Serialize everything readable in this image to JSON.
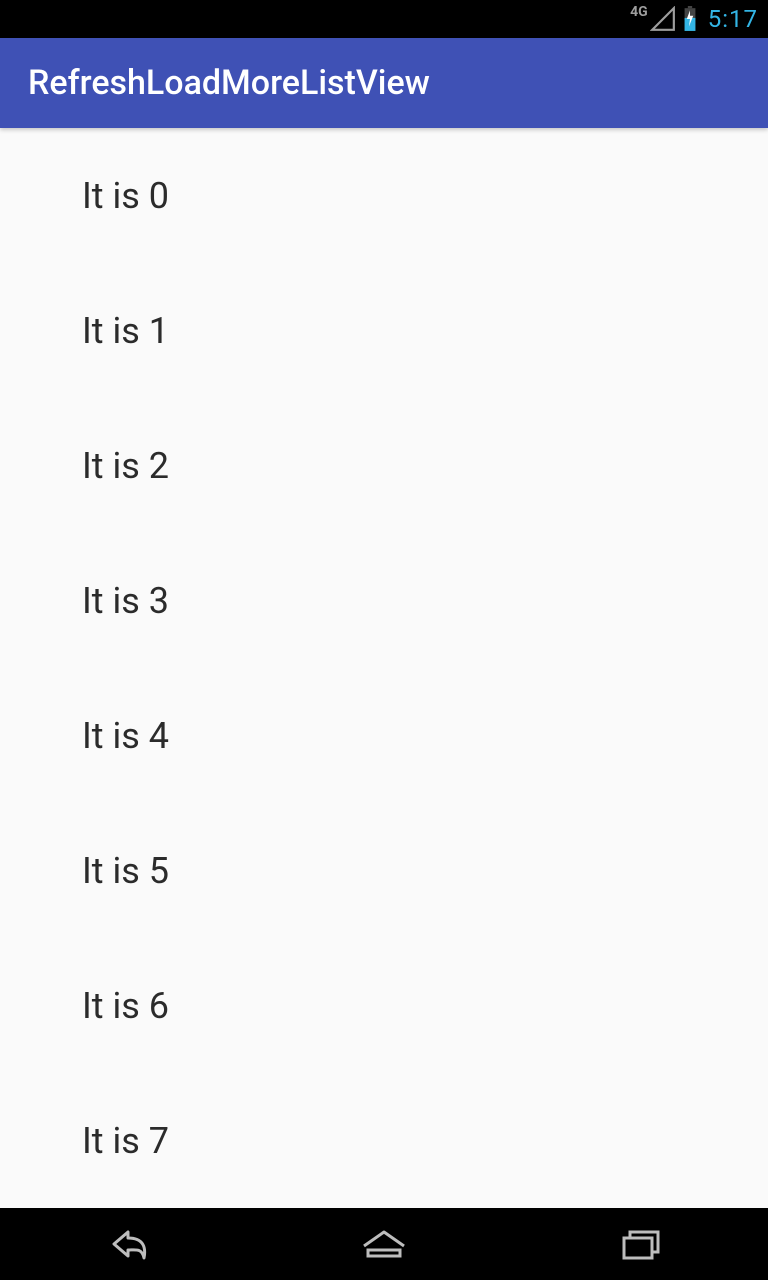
{
  "status": {
    "network_label": "4G",
    "time": "5:17"
  },
  "appbar": {
    "title": "RefreshLoadMoreListView"
  },
  "list": {
    "items": [
      {
        "label": "It is 0"
      },
      {
        "label": "It is 1"
      },
      {
        "label": "It is 2"
      },
      {
        "label": "It is 3"
      },
      {
        "label": "It is 4"
      },
      {
        "label": "It is 5"
      },
      {
        "label": "It is 6"
      },
      {
        "label": "It is 7"
      }
    ]
  }
}
